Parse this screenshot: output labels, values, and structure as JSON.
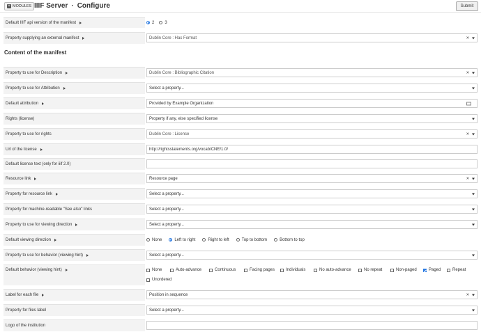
{
  "header": {
    "modules_label": "MODULES",
    "module_name": "IIIF Server",
    "separator": "·",
    "page": "Configure",
    "submit_label": "Submit"
  },
  "section_title": "Content of the manifest",
  "rows": {
    "api_version": {
      "label": "Default IIIF api version of the manifest",
      "options": [
        "2",
        "3"
      ],
      "selected": "2"
    },
    "external_manifest": {
      "label": "Property supplying an external manifest",
      "value": "Dublin Core : Has Format"
    },
    "description": {
      "label": "Property to use for Description",
      "value": "Dublin Core : Bibliographic Citation"
    },
    "attribution": {
      "label": "Property to use for Attribution",
      "placeholder": "Select a property..."
    },
    "default_attribution": {
      "label": "Default attribution",
      "value": "Provided by Example Organization"
    },
    "rights": {
      "label": "Rights (license)",
      "value": "Property if any, else specified license"
    },
    "rights_property": {
      "label": "Property to use for rights",
      "value": "Dublin Core : License"
    },
    "license_url": {
      "label": "Url of the license",
      "value": "http://rightsstatements.org/vocab/CNE/1.0/"
    },
    "license_text": {
      "label": "Default license text (only for iiif 2.0)",
      "value": ""
    },
    "resource_link": {
      "label": "Resource link",
      "value": "Resource page"
    },
    "resource_link_property": {
      "label": "Property for resource link",
      "placeholder": "Select a property..."
    },
    "see_also": {
      "label": "Property for machine-readable \"See also\" links",
      "placeholder": "Select a property..."
    },
    "viewing_direction_property": {
      "label": "Property to use for viewing direction",
      "placeholder": "Select a property..."
    },
    "viewing_direction": {
      "label": "Default viewing direction",
      "options": [
        "None",
        "Left to right",
        "Right to left",
        "Top to bottom",
        "Bottom to top"
      ],
      "selected": "Left to right"
    },
    "behavior_property": {
      "label": "Property to use for behavior (viewing hint)",
      "placeholder": "Select a property..."
    },
    "behavior": {
      "label": "Default behavior (viewing hint)",
      "options": [
        "None",
        "Auto-advance",
        "Continuous",
        "Facing pages",
        "Individuals",
        "No auto-advance",
        "No repeat",
        "Non-paged",
        "Paged",
        "Repeat",
        "Unordered"
      ],
      "checked": [
        "Paged"
      ]
    },
    "file_label": {
      "label": "Label for each file",
      "value": "Position in sequence"
    },
    "files_label_property": {
      "label": "Property for files label",
      "placeholder": "Select a property..."
    },
    "logo": {
      "label": "Logo of the institution",
      "value": ""
    }
  },
  "icons": {
    "remove": "close-icon",
    "dropdown": "chevron-down-icon",
    "expand": "caret-right-icon",
    "picker": "asset-picker-icon"
  },
  "colors": {
    "accent": "#2a7ae2",
    "label_bg": "#f3f3f3"
  }
}
